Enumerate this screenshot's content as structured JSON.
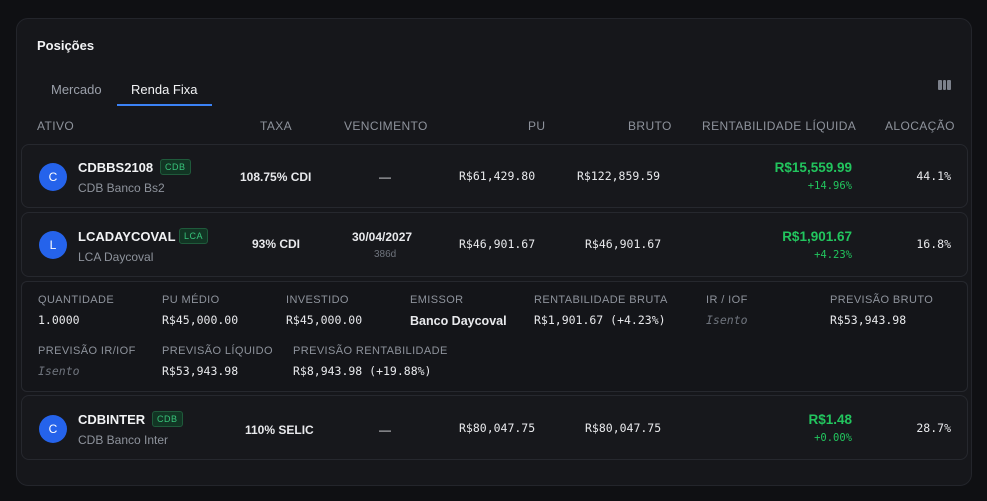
{
  "panel": {
    "title": "Posições"
  },
  "tabs": [
    {
      "label": "Mercado"
    },
    {
      "label": "Renda Fixa"
    }
  ],
  "table": {
    "headers": [
      "ATIVO",
      "TAXA",
      "VENCIMENTO",
      "PU",
      "BRUTO",
      "RENTABILIDADE LÍQUIDA",
      "ALOCAÇÃO"
    ],
    "rows": [
      {
        "avatar": "C",
        "code": "CDBBS2108",
        "badge": "CDB",
        "name": "CDB Banco Bs2",
        "rate": "108.75% CDI",
        "maturity": "—",
        "maturity_days": "",
        "pu": "R$61,429.80",
        "gross": "R$122,859.59",
        "net": "R$15,559.99",
        "net_pct": "+14.96%",
        "allocation": "44.1%"
      },
      {
        "avatar": "L",
        "code": "LCADAYCOVAL",
        "badge": "LCA",
        "name": "LCA Daycoval",
        "rate": "93% CDI",
        "maturity": "30/04/2027",
        "maturity_days": "386d",
        "pu": "R$46,901.67",
        "gross": "R$46,901.67",
        "net": "R$1,901.67",
        "net_pct": "+4.23%",
        "allocation": "16.8%"
      },
      {
        "avatar": "C",
        "code": "CDBINTER",
        "badge": "CDB",
        "name": "CDB Banco Inter",
        "rate": "110% SELIC",
        "maturity": "—",
        "maturity_days": "",
        "pu": "R$80,047.75",
        "gross": "R$80,047.75",
        "net": "R$1.48",
        "net_pct": "+0.00%",
        "allocation": "28.7%"
      }
    ]
  },
  "detail": {
    "quantity_label": "QUANTIDADE",
    "quantity": "1.0000",
    "avg_pu_label": "PU MÉDIO",
    "avg_pu": "R$45,000.00",
    "invested_label": "INVESTIDO",
    "invested": "R$45,000.00",
    "issuer_label": "EMISSOR",
    "issuer": "Banco Daycoval",
    "gross_return_label": "RENTABILIDADE BRUTA",
    "gross_return": "R$1,901.67 (+4.23%)",
    "ir_iof_label": "IR / IOF",
    "ir_iof": "Isento",
    "forecast_gross_label": "PREVISÃO BRUTO",
    "forecast_gross": "R$53,943.98",
    "forecast_ir_label": "PREVISÃO IR/IOF",
    "forecast_ir": "Isento",
    "forecast_net_label": "PREVISÃO LÍQUIDO",
    "forecast_net": "R$53,943.98",
    "forecast_return_label": "PREVISÃO RENTABILIDADE",
    "forecast_return": "R$8,943.98 (+19.88%)"
  },
  "colors": {
    "accent": "#3b82f6",
    "positive": "#22c55e",
    "avatar": "#2563eb"
  },
  "icons": {
    "columns": "columns-icon"
  }
}
